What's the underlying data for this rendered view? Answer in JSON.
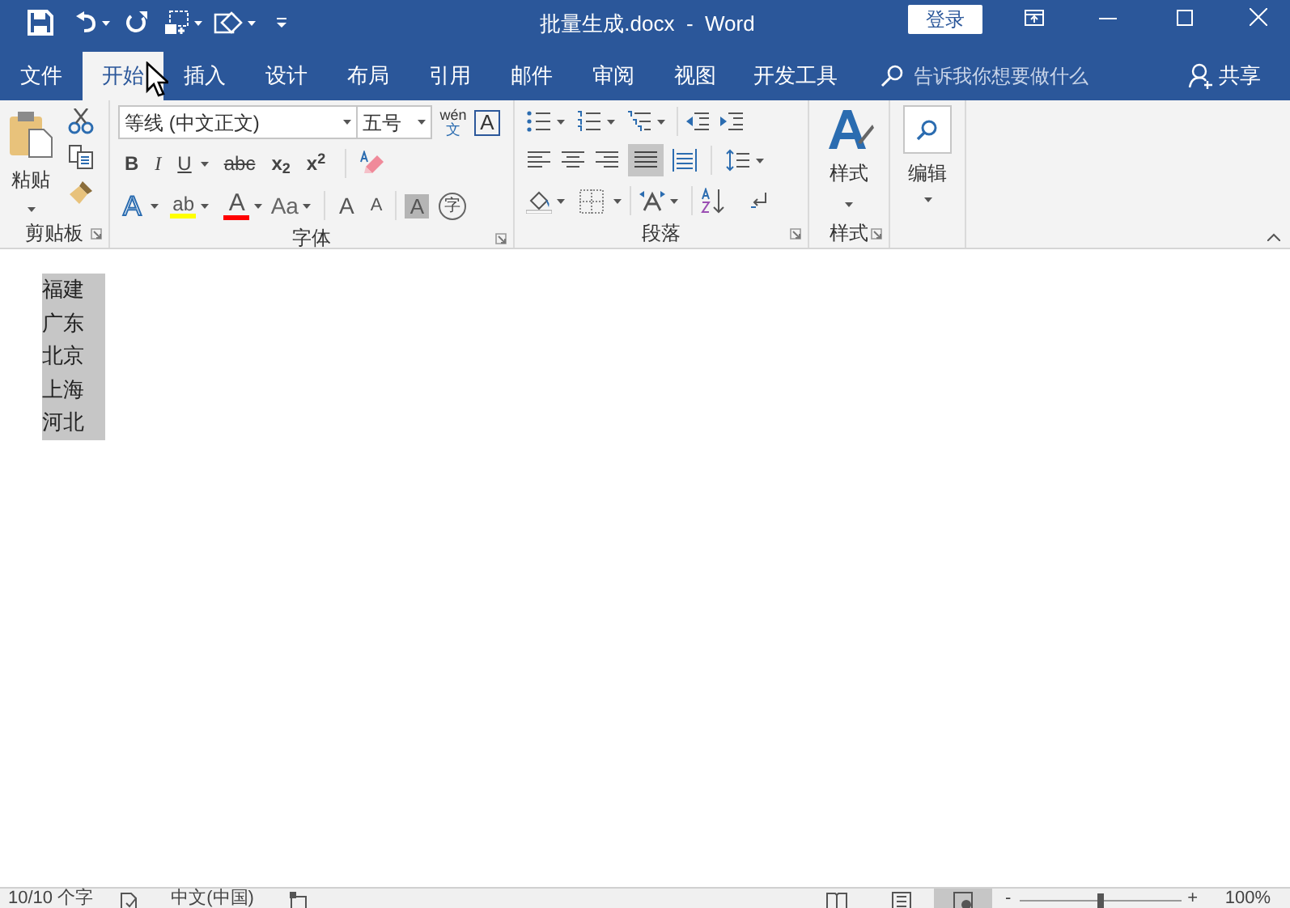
{
  "title_bar": {
    "title": "批量生成.docx  -  Word",
    "login_button": "登录"
  },
  "tabs": [
    {
      "label": "文件",
      "selected": false
    },
    {
      "label": "开始",
      "selected": true
    },
    {
      "label": "插入",
      "selected": false
    },
    {
      "label": "设计",
      "selected": false
    },
    {
      "label": "布局",
      "selected": false
    },
    {
      "label": "引用",
      "selected": false
    },
    {
      "label": "邮件",
      "selected": false
    },
    {
      "label": "审阅",
      "selected": false
    },
    {
      "label": "视图",
      "selected": false
    },
    {
      "label": "开发工具",
      "selected": false
    }
  ],
  "tell_me": {
    "placeholder": "告诉我你想要做什么"
  },
  "share_button": "共享",
  "clipboard": {
    "paste": "粘贴",
    "label": "剪贴板"
  },
  "font": {
    "name": "等线 (中文正文)",
    "size": "五号",
    "phonetic_top": "wén",
    "phonetic_bottom": "文",
    "border_char": "A",
    "format_buttons": [
      {
        "text": "B",
        "kind": "bold"
      },
      {
        "text": "I",
        "kind": "italic"
      },
      {
        "text": "U",
        "kind": "underline"
      },
      {
        "text": "abc",
        "kind": "strike"
      },
      {
        "text": "x$_{2}$",
        "kind": "sub"
      },
      {
        "text": "x$^{2}$",
        "kind": "sup"
      }
    ],
    "effect_char": "A",
    "highlight": {
      "text": "ab",
      "color": "#ffff00"
    },
    "font_color": {
      "text": "A",
      "color": "#ff0000"
    },
    "case_text": "Aa",
    "grow_char": "A",
    "shrink_char": "A",
    "shade_char": "A",
    "enclose_char": "字",
    "label": "字体"
  },
  "paragraph": {
    "label": "段落"
  },
  "styles": {
    "button": "样式",
    "label": "样式"
  },
  "editing": {
    "button": "编辑"
  },
  "document": {
    "lines": [
      {
        "text": "福建",
        "selected": true
      },
      {
        "text": "广东",
        "selected": true
      },
      {
        "text": "北京",
        "selected": true
      },
      {
        "text": "上海",
        "selected": true
      },
      {
        "text": "河北",
        "selected": true
      }
    ]
  },
  "status_bar": {
    "word_count": "10/10 个字",
    "language": "中文(中国)",
    "zoom_out": "-",
    "zoom_slider": {
      "level": 0.5
    },
    "zoom_in": "+",
    "zoom": "100%"
  }
}
